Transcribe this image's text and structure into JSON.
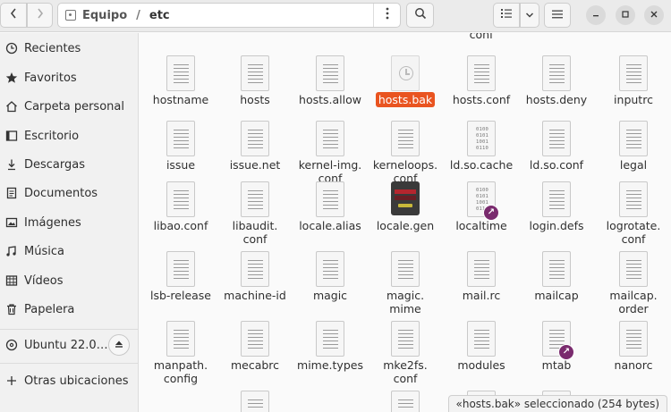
{
  "header": {
    "path": [
      "Equipo",
      "etc"
    ],
    "path_separator": "/"
  },
  "sidebar": {
    "items": [
      {
        "label": "Recientes",
        "icon": "clock-icon"
      },
      {
        "label": "Favoritos",
        "icon": "star-icon"
      },
      {
        "label": "Carpeta personal",
        "icon": "home-icon"
      },
      {
        "label": "Escritorio",
        "icon": "desktop-icon"
      },
      {
        "label": "Descargas",
        "icon": "download-icon"
      },
      {
        "label": "Documentos",
        "icon": "document-icon"
      },
      {
        "label": "Imágenes",
        "icon": "image-icon"
      },
      {
        "label": "Música",
        "icon": "music-icon"
      },
      {
        "label": "Vídeos",
        "icon": "video-icon"
      },
      {
        "label": "Papelera",
        "icon": "trash-icon"
      }
    ],
    "devices": [
      {
        "label": "Ubuntu 22.0…",
        "icon": "disc-icon"
      }
    ],
    "other": {
      "label": "Otras ubicaciones",
      "icon": "plus-icon"
    }
  },
  "files": {
    "top_partial": {
      "line1": "",
      "line2": "conf"
    },
    "rows": [
      [
        "hostname",
        "hosts",
        "hosts.allow",
        "hosts.bak",
        "hosts.conf",
        "hosts.deny",
        "inputrc"
      ],
      [
        "issue",
        "issue.net",
        "kernel-img.\nconf",
        "kerneloops.\nconf",
        "ld.so.cache",
        "ld.so.conf",
        "legal"
      ],
      [
        "libao.conf",
        "libaudit.\nconf",
        "locale.alias",
        "locale.gen",
        "localtime",
        "login.defs",
        "logrotate.\nconf"
      ],
      [
        "lsb-release",
        "machine-id",
        "magic",
        "magic.\nmime",
        "mail.rc",
        "mailcap",
        "mailcap.\norder"
      ],
      [
        "manpath.\nconfig",
        "mecabrc",
        "mime.types",
        "mke2fs.\nconf",
        "modules",
        "mtab",
        "nanorc"
      ]
    ],
    "selected": "hosts.bak"
  },
  "status": {
    "text": "«hosts.bak» seleccionado  (254 bytes)"
  },
  "colors": {
    "selection": "#e95420",
    "symlink_badge": "#7a2b6e"
  }
}
